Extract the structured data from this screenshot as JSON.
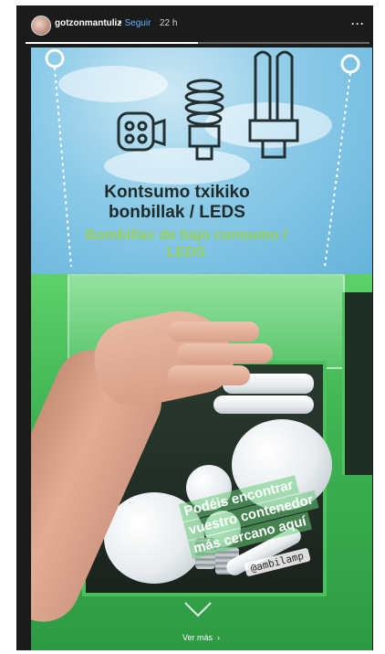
{
  "header": {
    "username": "gotzonmantuliz",
    "separator": "•",
    "follow_label": "Seguir",
    "time_ago": "22 h",
    "more_label": "···",
    "progress_fraction": 0.5
  },
  "sign": {
    "line_basque": "Kontsumo txikiko bonbillak / LEDS",
    "line_spanish": "Bombillas de bajo consumo / LEDS"
  },
  "caption": {
    "lines": [
      "Podéis encontrar",
      "vuestro contenedor",
      "más cercano aquí"
    ],
    "mention": "@ambilamp"
  },
  "footer": {
    "see_more_label": "Ver más",
    "see_more_arrow": "›"
  },
  "colors": {
    "link": "#5fb4ff",
    "bin_green": "#3fb352"
  }
}
